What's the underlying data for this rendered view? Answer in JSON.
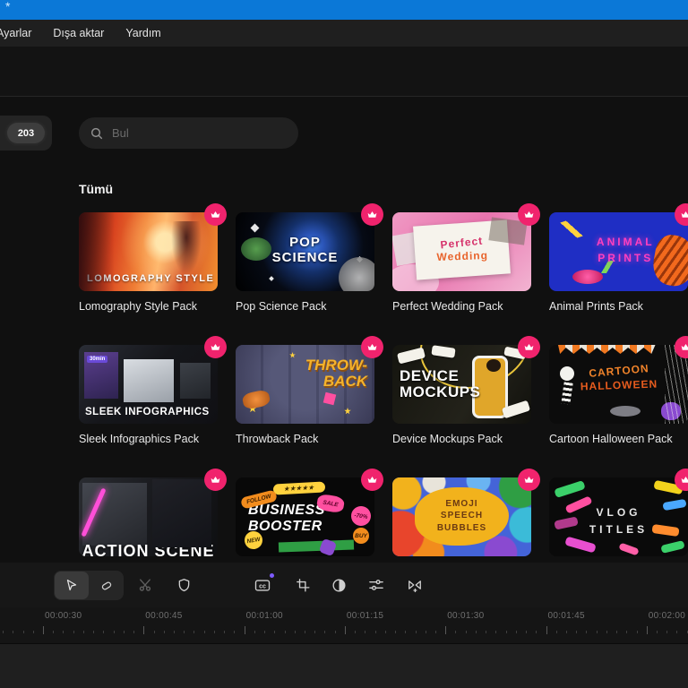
{
  "window": {
    "modified_indicator": "*"
  },
  "colors": {
    "titlebar": "#0b78d7",
    "premium_badge": "#f0236d",
    "cc_notification_dot": "#7e5bff"
  },
  "menubar": {
    "items": [
      {
        "label": "Ayarlar"
      },
      {
        "label": "Dışa aktar"
      },
      {
        "label": "Yardım"
      }
    ]
  },
  "library": {
    "tab_count_badge": "203",
    "search_placeholder": "Bul",
    "section_title": "Tümü",
    "cards": [
      {
        "caption": "Lomography Style Pack",
        "line1": "LOMOGRAPHY STYLE",
        "premium": true
      },
      {
        "caption": "Pop Science Pack",
        "line1": "POP",
        "line2": "SCIENCE",
        "premium": true
      },
      {
        "caption": "Perfect Wedding Pack",
        "line1": "Perfect",
        "line2": "Wedding",
        "premium": true
      },
      {
        "caption": "Animal Prints Pack",
        "line1": "ANIMAL",
        "line2": "PRINTS",
        "premium": true
      },
      {
        "caption": "Sleek Infographics Pack",
        "line1": "SLEEK INFOGRAPHICS",
        "tile_label": "30min",
        "premium": true
      },
      {
        "caption": "Throwback Pack",
        "line1": "THROW-",
        "line2": "BACK",
        "premium": true
      },
      {
        "caption": "Device Mockups Pack",
        "line1": "DEVICE",
        "line2": "MOCKUPS",
        "premium": true
      },
      {
        "caption": "Cartoon Halloween Pack",
        "line1": "CARTOON",
        "line2": "HALLOWEEN",
        "premium": true
      },
      {
        "line1": "ACTION SCENE",
        "premium": true
      },
      {
        "line1": "BUSINESS",
        "line2": "BOOSTER",
        "premium": true,
        "stickers": {
          "stars": "★★★★★",
          "follow": "FOLLOW",
          "sale": "SALE",
          "discount": "-70%",
          "new": "NEW",
          "buy": "BUY"
        }
      },
      {
        "line1": "EMOJI",
        "line2": "SPEECH",
        "line3": "BUBBLES",
        "premium": true
      },
      {
        "line1": "VLOG",
        "line2": "TITLES",
        "premium": true
      }
    ]
  },
  "toolbar": {
    "cc_label": "cc",
    "icons": [
      "select-cursor",
      "slip-tool",
      "split-scissors",
      "mask-shield",
      "captions-cc",
      "crop",
      "contrast",
      "adjust-sliders",
      "mirror-flip"
    ]
  },
  "timeline": {
    "ruler_labels": [
      "00:00:30",
      "00:00:45",
      "00:01:00",
      "00:01:15",
      "00:01:30",
      "00:01:45",
      "00:02:00"
    ]
  }
}
